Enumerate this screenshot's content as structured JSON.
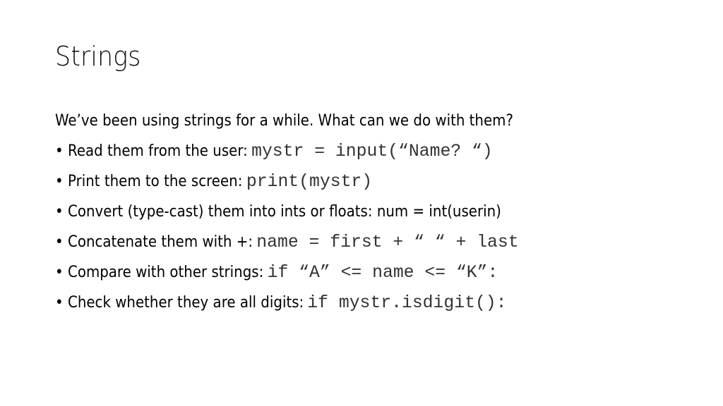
{
  "slide": {
    "title": "Strings",
    "intro": "We’ve been  using strings for a while. What can we do with them?",
    "bullets": [
      {
        "text": "Read them from the user:",
        "code": "mystr = input(“Name? “)"
      },
      {
        "text": "Print them to the screen:",
        "code": "print(mystr)"
      },
      {
        "text": "Convert (type-cast) them into ints or floats:  num = int(userin)",
        "code": ""
      },
      {
        "text": "Concatenate them with +:",
        "code": "name = first + “ “ + last"
      },
      {
        "text": "Compare with other strings:",
        "code": "if “A” <= name <= “K”:"
      },
      {
        "text": "Check whether they are all digits:",
        "code": "if mystr.isdigit():"
      }
    ],
    "bullet_glyph": "•"
  }
}
